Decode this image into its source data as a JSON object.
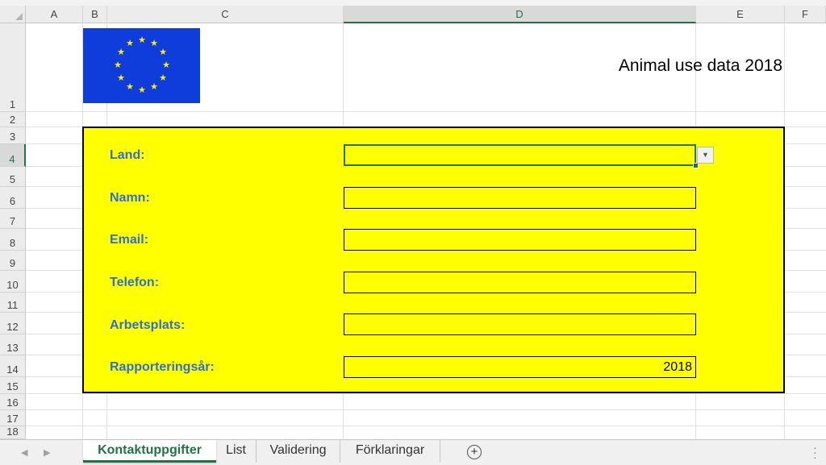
{
  "columns": [
    "A",
    "B",
    "C",
    "D",
    "E",
    "F"
  ],
  "rows": [
    "1",
    "2",
    "3",
    "4",
    "5",
    "6",
    "7",
    "8",
    "9",
    "10",
    "11",
    "12",
    "13",
    "14",
    "15",
    "16",
    "17",
    "18"
  ],
  "title": "Animal use data 2018",
  "form": {
    "land_label": "Land:",
    "land_value": "",
    "namn_label": "Namn:",
    "namn_value": "",
    "email_label": "Email:",
    "email_value": "",
    "telefon_label": "Telefon:",
    "telefon_value": "",
    "arbetsplats_label": "Arbetsplats:",
    "arbetsplats_value": "",
    "rapporteringsar_label": "Rapporteringsår:",
    "rapporteringsar_value": "2018"
  },
  "sheets": [
    "Kontaktuppgifter",
    "List",
    "Validering",
    "Förklaringar"
  ],
  "active_sheet": "Kontaktuppgifter",
  "colors": {
    "form_bg": "#ffff00",
    "label": "#2e6fd4",
    "excel_green": "#217346",
    "flag_blue": "#0f3ddb",
    "star_yellow": "#ffec00"
  },
  "icons": {
    "flag": "eu-flag-icon",
    "dropdown": "dropdown-arrow-icon",
    "add_sheet": "plus-circle-icon"
  }
}
